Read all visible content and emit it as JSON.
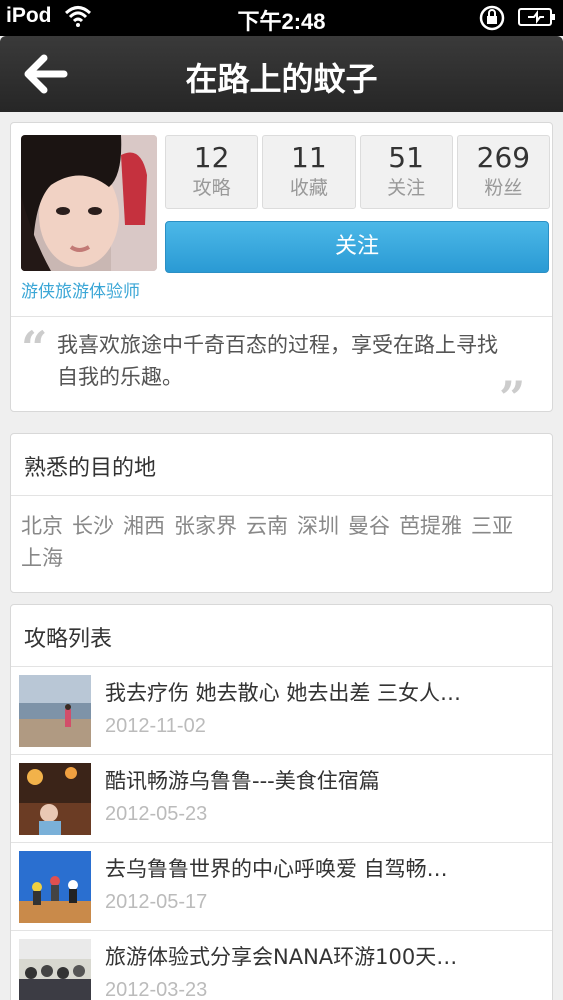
{
  "status_bar": {
    "carrier": "iPod",
    "time": "下午2:48"
  },
  "nav": {
    "title": "在路上的蚊子"
  },
  "profile": {
    "role": "游侠旅游体验师",
    "stats": [
      {
        "value": "12",
        "label": "攻略"
      },
      {
        "value": "11",
        "label": "收藏"
      },
      {
        "value": "51",
        "label": "关注"
      },
      {
        "value": "269",
        "label": "粉丝"
      }
    ],
    "follow_label": "关注",
    "bio": "我喜欢旅途中千奇百态的过程，享受在路上寻找自我的乐趣。"
  },
  "destinations": {
    "title": "熟悉的目的地",
    "items": [
      "北京",
      "长沙",
      "湘西",
      "张家界",
      "云南",
      "深圳",
      "曼谷",
      "芭提雅",
      "三亚",
      "上海"
    ]
  },
  "guides": {
    "title": "攻略列表",
    "items": [
      {
        "title": "我去疗伤 她去散心 她去出差 三女人…",
        "date": "2012-11-02"
      },
      {
        "title": "酷讯畅游乌鲁鲁---美食住宿篇",
        "date": "2012-05-23"
      },
      {
        "title": "去乌鲁鲁世界的中心呼唤爱 自驾畅…",
        "date": "2012-05-17"
      },
      {
        "title": "旅游体验式分享会NANA环游100天…",
        "date": "2012-03-23"
      }
    ]
  },
  "colors": {
    "accent": "#3aa6d6",
    "navbar": "#2e2e2e"
  }
}
